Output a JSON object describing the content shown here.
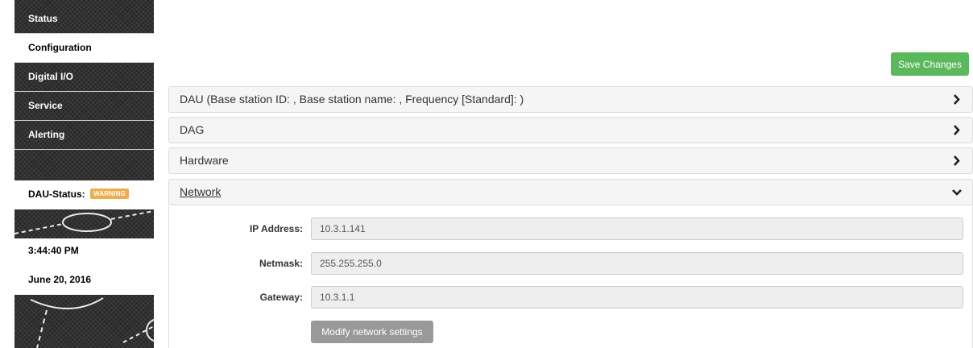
{
  "sidebar": {
    "items": [
      {
        "label": "Status"
      },
      {
        "label": "Configuration"
      },
      {
        "label": "Digital I/O"
      },
      {
        "label": "Service"
      },
      {
        "label": "Alerting"
      }
    ],
    "status_label": "DAU-Status:",
    "status_badge": "WARNING",
    "time": "3:44:40 PM",
    "date": "June 20, 2016"
  },
  "toolbar": {
    "save_label": "Save Changes"
  },
  "panels": [
    {
      "title": "DAU (Base station ID: , Base station name: , Frequency [Standard]: )",
      "expanded": false
    },
    {
      "title": "DAG",
      "expanded": false
    },
    {
      "title": "Hardware",
      "expanded": false
    },
    {
      "title": "Network",
      "expanded": true
    }
  ],
  "network": {
    "fields": [
      {
        "label": "IP Address:",
        "value": "10.3.1.141"
      },
      {
        "label": "Netmask:",
        "value": "255.255.255.0"
      },
      {
        "label": "Gateway:",
        "value": "10.3.1.1"
      }
    ],
    "modify_label": "Modify network settings"
  },
  "colors": {
    "success": "#5cb85c",
    "warning": "#f0ad4e",
    "sidebar_bg": "#2a2a2a",
    "disabled_button": "#999999"
  }
}
